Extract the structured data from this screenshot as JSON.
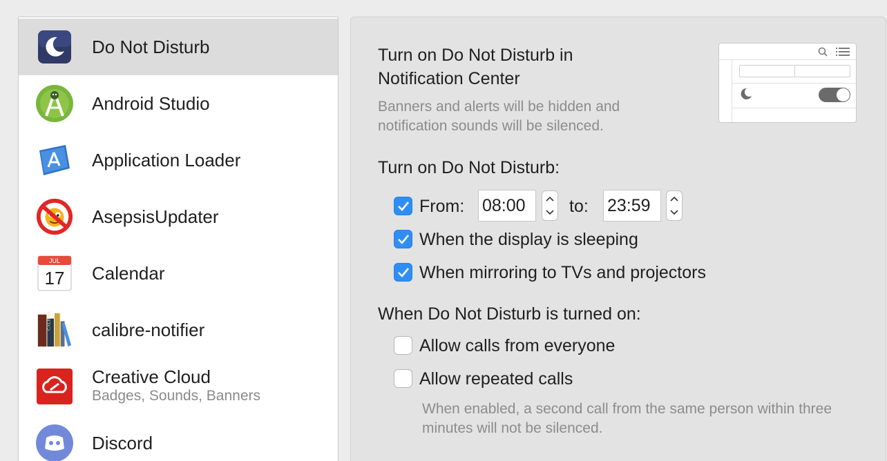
{
  "sidebar": {
    "items": [
      {
        "name": "Do Not Disturb",
        "icon": "moon-icon",
        "selected": true
      },
      {
        "name": "Android Studio",
        "icon": "android-studio-icon"
      },
      {
        "name": "Application Loader",
        "icon": "application-loader-icon"
      },
      {
        "name": "AsepsisUpdater",
        "icon": "asepsis-updater-icon"
      },
      {
        "name": "Calendar",
        "icon": "calendar-icon",
        "icon_month": "JUL",
        "icon_day": "17"
      },
      {
        "name": "calibre-notifier",
        "icon": "calibre-books-icon",
        "icon_spine": "CALIBRE"
      },
      {
        "name": "Creative Cloud",
        "subtitle": "Badges, Sounds, Banners",
        "icon": "creative-cloud-icon"
      },
      {
        "name": "Discord",
        "icon": "discord-icon"
      }
    ]
  },
  "panel": {
    "title": "Turn on Do Not Disturb in Notification Center",
    "description": "Banners and alerts will be hidden and notification sounds will be silenced.",
    "schedule_heading": "Turn on Do Not Disturb:",
    "from_label": "From:",
    "from_value": "08:00",
    "to_label": "to:",
    "to_value": "23:59",
    "from_checked": true,
    "display_sleeping_label": "When the display is sleeping",
    "display_sleeping_checked": true,
    "mirroring_label": "When mirroring to TVs and projectors",
    "mirroring_checked": true,
    "when_on_heading": "When Do Not Disturb is turned on:",
    "allow_calls_label": "Allow calls from everyone",
    "allow_calls_checked": false,
    "repeated_calls_label": "Allow repeated calls",
    "repeated_calls_checked": false,
    "repeated_calls_note": "When enabled, a second call from the same person within three minutes will not be silenced."
  },
  "colors": {
    "accent": "#2e8ef5",
    "selected_row": "#dcdcdc",
    "panel_bg": "#e3e3e3"
  }
}
